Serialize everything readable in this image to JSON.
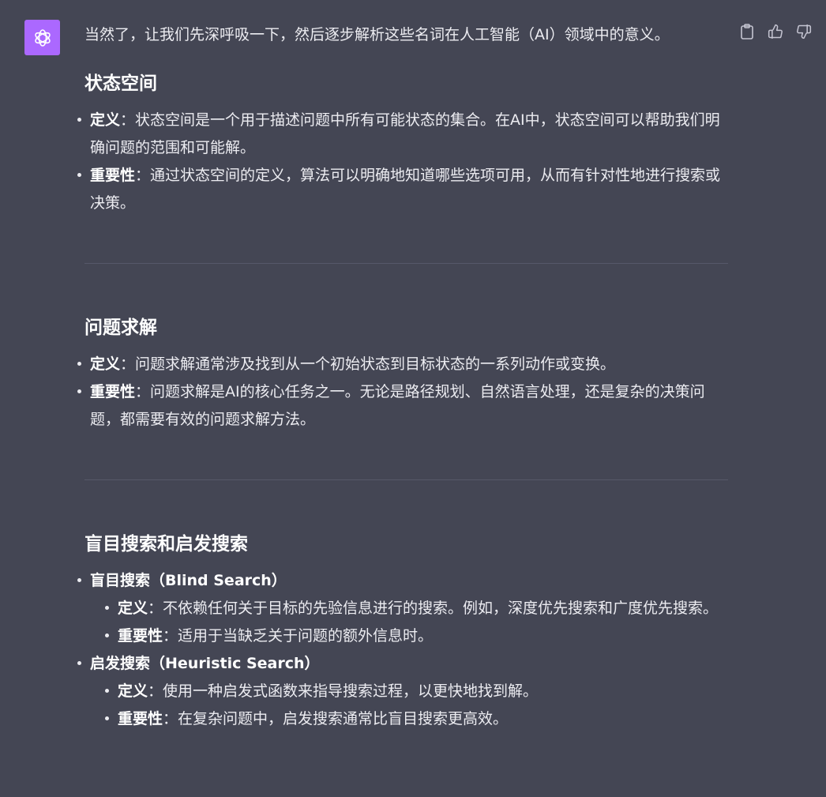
{
  "intro": "当然了，让我们先深呼吸一下，然后逐步解析这些名词在人工智能（AI）领域中的意义。",
  "sections": [
    {
      "title": "状态空间",
      "items": [
        {
          "label": "定义",
          "sep": "：",
          "text": "状态空间是一个用于描述问题中所有可能状态的集合。在AI中，状态空间可以帮助我们明确问题的范围和可能解。"
        },
        {
          "label": "重要性",
          "sep": "：",
          "text": "通过状态空间的定义，算法可以明确地知道哪些选项可用，从而有针对性地进行搜索或决策。"
        }
      ]
    },
    {
      "title": "问题求解",
      "items": [
        {
          "label": "定义",
          "sep": "：",
          "text": "问题求解通常涉及找到从一个初始状态到目标状态的一系列动作或变换。"
        },
        {
          "label": "重要性",
          "sep": "：",
          "text": "问题求解是AI的核心任务之一。无论是路径规划、自然语言处理，还是复杂的决策问题，都需要有效的问题求解方法。"
        }
      ]
    },
    {
      "title": "盲目搜索和启发搜索",
      "groups": [
        {
          "label": "盲目搜索（Blind Search）",
          "items": [
            {
              "label": "定义",
              "sep": "：",
              "text": "不依赖任何关于目标的先验信息进行的搜索。例如，深度优先搜索和广度优先搜索。"
            },
            {
              "label": "重要性",
              "sep": "：",
              "text": "适用于当缺乏关于问题的额外信息时。"
            }
          ]
        },
        {
          "label": "启发搜索（Heuristic Search）",
          "items": [
            {
              "label": "定义",
              "sep": "：",
              "text": "使用一种启发式函数来指导搜索过程，以更快地找到解。"
            },
            {
              "label": "重要性",
              "sep": "：",
              "text": "在复杂问题中，启发搜索通常比盲目搜索更高效。"
            }
          ]
        }
      ]
    }
  ],
  "icons": {
    "avatar": "openai-logo-icon",
    "copy": "clipboard-icon",
    "like": "thumbs-up-icon",
    "dislike": "thumbs-down-icon"
  },
  "colors": {
    "background": "#444654",
    "avatar": "#ab68ff",
    "text": "#ececf1",
    "divider": "#565869"
  }
}
